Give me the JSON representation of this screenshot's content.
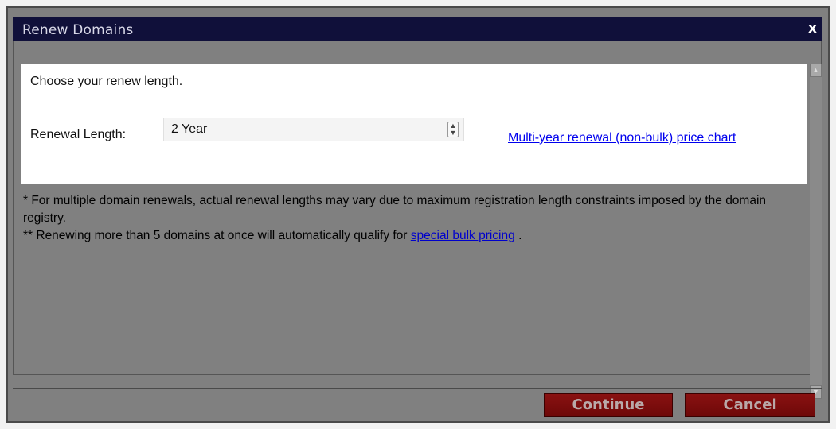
{
  "dialog": {
    "title": "Renew Domains",
    "close_label": "x"
  },
  "panel": {
    "instruction": "Choose your renew length.",
    "renewal_label": "Renewal Length:",
    "renewal_selected": "2 Year",
    "price_chart_link": "Multi-year renewal (non-bulk) price chart"
  },
  "notes": {
    "note1": "* For multiple domain renewals, actual renewal lengths may vary due to maximum registration length constraints imposed by the domain registry.",
    "note2_prefix": "** Renewing more than 5 domains at once will automatically qualify for",
    "note2_link": "special bulk pricing",
    "note2_suffix": "."
  },
  "footer": {
    "continue_label": "Continue",
    "cancel_label": "Cancel"
  },
  "colors": {
    "titlebar": "#10103a",
    "dialog_body": "#808080",
    "button": "#7a0c0c",
    "link": "#0000ee"
  },
  "icons": {
    "select_arrows": "up-down-arrows-icon",
    "scroll_up": "scroll-up-arrow-icon",
    "scroll_down": "scroll-down-arrow-icon",
    "close": "close-icon"
  }
}
